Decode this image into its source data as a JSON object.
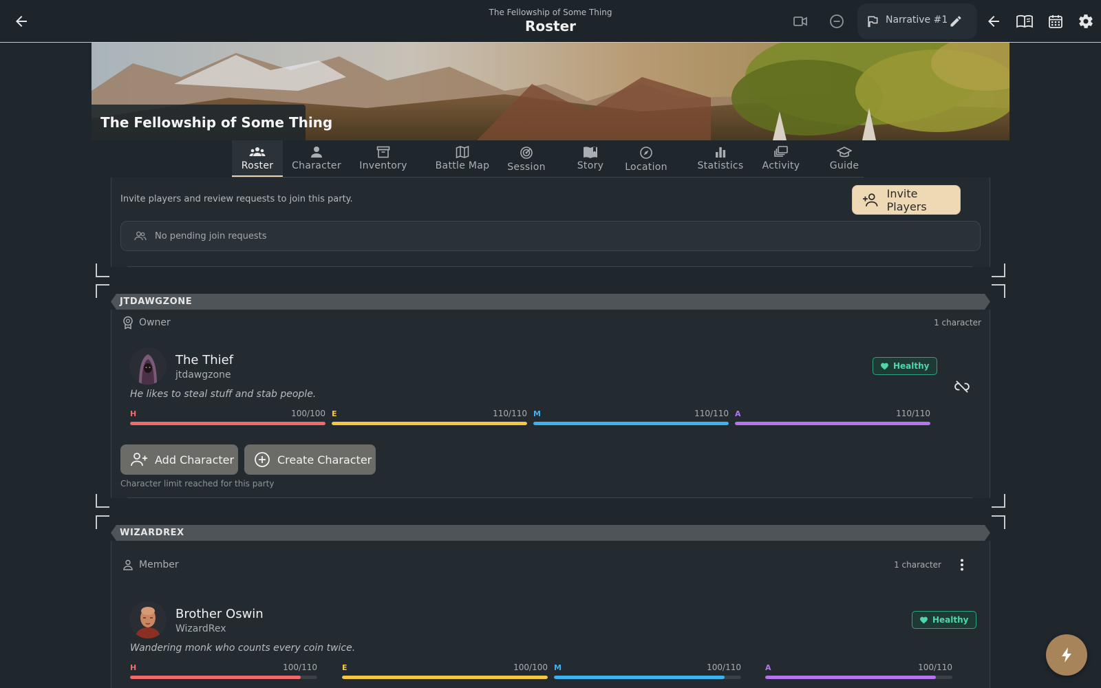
{
  "header": {
    "subtitle": "The Fellowship of Some Thing",
    "title": "Roster",
    "narrative_label": "Narrative #1",
    "icons": [
      "back-arrow-icon",
      "video-camera-icon",
      "minus-circle-icon",
      "flag-icon",
      "pencil-icon",
      "back-arrow-icon",
      "book-open-icon",
      "calendar-icon",
      "gear-icon"
    ]
  },
  "banner": {
    "party_name": "The Fellowship of Some Thing"
  },
  "tabs": [
    {
      "label": "Roster",
      "icon": "roster-icon",
      "active": true
    },
    {
      "label": "Character",
      "icon": "person-icon"
    },
    {
      "label": "Inventory",
      "icon": "archive-icon"
    },
    {
      "label": "Battle Map",
      "icon": "map-icon"
    },
    {
      "label": "Session",
      "icon": "radar-icon"
    },
    {
      "label": "Story",
      "icon": "story-book-icon"
    },
    {
      "label": "Location",
      "icon": "compass-icon"
    },
    {
      "label": "Statistics",
      "icon": "bar-chart-icon"
    },
    {
      "label": "Activity",
      "icon": "activity-stack-icon"
    },
    {
      "label": "Guide",
      "icon": "graduation-cap-icon"
    }
  ],
  "invite": {
    "description": "Invite players and review requests to join this party.",
    "button_label": "Invite Players",
    "pending_text": "No pending join requests"
  },
  "groups": [
    {
      "player": "JTDAWGZONE",
      "role": "Owner",
      "count": "1 character",
      "character": {
        "name": "The Thief",
        "user": "jtdawgzone",
        "description": "He likes to steal stuff and stab people.",
        "status": "Healthy",
        "stats": [
          {
            "letter": "H",
            "value": "100/100",
            "fill": 1.0,
            "color": "#f06a6a"
          },
          {
            "letter": "E",
            "value": "110/110",
            "fill": 1.0,
            "color": "#f5c842"
          },
          {
            "letter": "M",
            "value": "110/110",
            "fill": 1.0,
            "color": "#3db2f0"
          },
          {
            "letter": "A",
            "value": "110/110",
            "fill": 1.0,
            "color": "#b674f0"
          }
        ]
      },
      "add_character": "Add Character",
      "create_character": "Create Character",
      "limit_text": "Character limit reached for this party"
    },
    {
      "player": "WIZARDREX",
      "role": "Member",
      "count": "1 character",
      "character": {
        "name": "Brother Oswin",
        "user": "WizardRex",
        "description": "Wandering monk who counts every coin twice.",
        "status": "Healthy",
        "stats": [
          {
            "letter": "H",
            "value": "100/110",
            "fill": 0.91,
            "color": "#f06a6a"
          },
          {
            "letter": "E",
            "value": "100/100",
            "fill": 1.0,
            "color": "#f5c842"
          },
          {
            "letter": "M",
            "value": "100/110",
            "fill": 0.91,
            "color": "#3db2f0"
          },
          {
            "letter": "A",
            "value": "100/110",
            "fill": 0.91,
            "color": "#b674f0"
          }
        ]
      }
    }
  ],
  "colors": {
    "background": "#1f272d",
    "accent": "#efd9b4",
    "healthy": "#4fd6aa",
    "fab": "#a8845a"
  }
}
